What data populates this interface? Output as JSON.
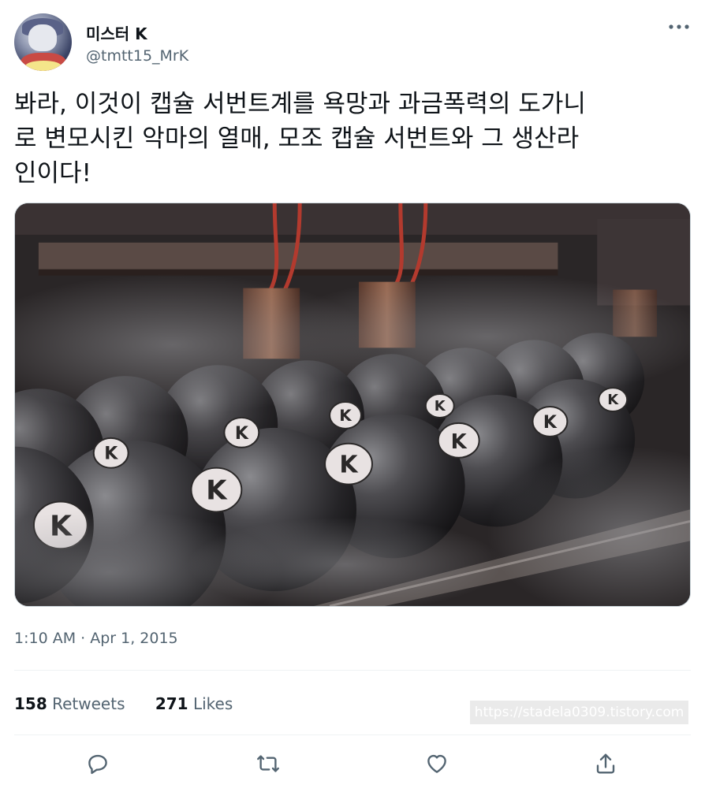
{
  "author": {
    "name": "미스터 K",
    "handle": "@tmtt15_MrK"
  },
  "tweet": {
    "text": "봐라, 이것이 캡슐 서번트계를 욕망과 과금폭력의 도가니\n로 변모시킨 악마의 열매, 모조 캡슐 서번트와 그 생산라\n인이다!",
    "timestamp": "1:10 AM · Apr 1, 2015"
  },
  "stats": {
    "retweets_count": "158",
    "retweets_label": "Retweets",
    "likes_count": "271",
    "likes_label": "Likes"
  },
  "watermark": "https://stadela0309.tistory.com",
  "media": {
    "capsule_mark": "K"
  },
  "icons": {
    "more": "more-icon",
    "reply": "reply-icon",
    "retweet": "retweet-icon",
    "like": "like-icon",
    "share": "share-icon"
  }
}
